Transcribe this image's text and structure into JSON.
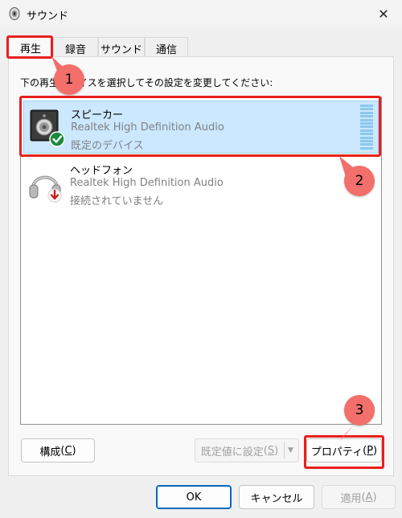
{
  "window": {
    "title": "サウンド",
    "close_glyph": "✕"
  },
  "tabs": [
    {
      "label": "再生",
      "active": true
    },
    {
      "label": "録音",
      "active": false
    },
    {
      "label": "サウンド",
      "active": false
    },
    {
      "label": "通信",
      "active": false
    }
  ],
  "panel": {
    "instruction": "下の再生デバイスを選択してその設定を変更してください:"
  },
  "devices": [
    {
      "name": "スピーカー",
      "driver": "Realtek High Definition Audio",
      "status": "既定のデバイス",
      "icon": "speaker-icon",
      "badge": "check-badge-icon",
      "selected": true
    },
    {
      "name": "ヘッドフォン",
      "driver": "Realtek High Definition Audio",
      "status": "接続されていません",
      "icon": "headphones-icon",
      "badge": "down-arrow-badge-icon",
      "selected": false
    }
  ],
  "buttons": {
    "configure_label": "構成",
    "configure_key": "C",
    "set_default_label": "既定値に設定",
    "set_default_key": "S",
    "properties_label": "プロパティ",
    "properties_key": "P",
    "ok_label": "OK",
    "cancel_label": "キャンセル",
    "apply_label": "適用",
    "apply_key": "A"
  },
  "annotations": {
    "c1": "1",
    "c2": "2",
    "c3": "3"
  },
  "colors": {
    "highlight": "#e8201d",
    "callout": "#f26f6b",
    "selection": "#cce8ff",
    "accent": "#0067c0"
  }
}
